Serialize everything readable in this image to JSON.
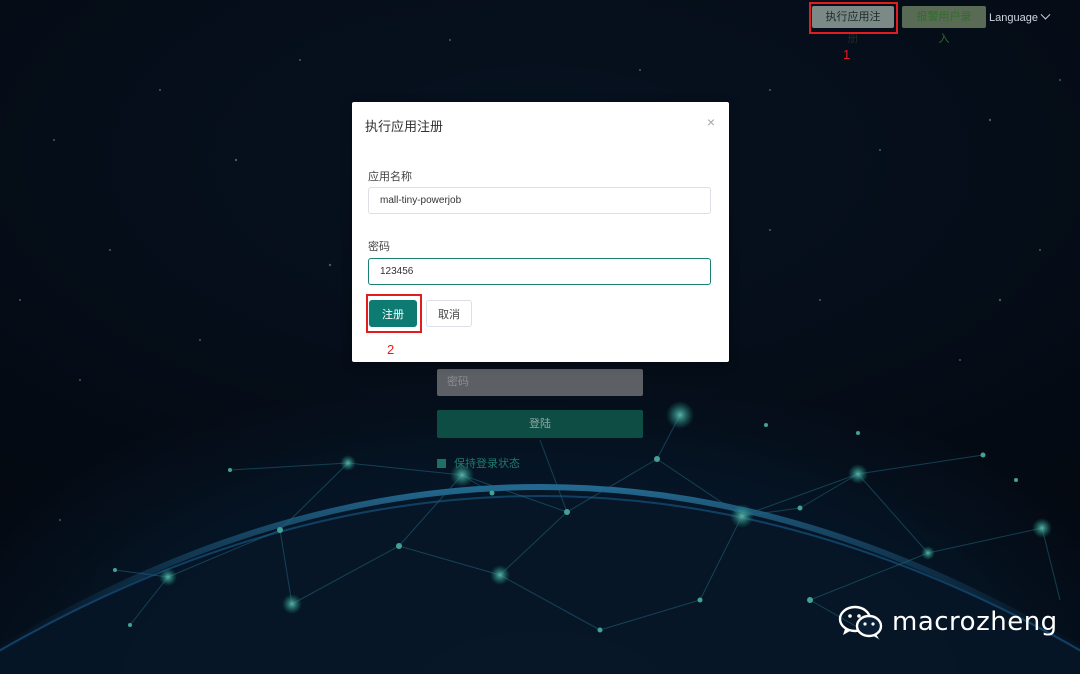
{
  "topbar": {
    "exec_register_label": "执行应用注册",
    "user_entry_label": "报警用户录入",
    "language_label": "Language"
  },
  "markers": {
    "first": "1",
    "second": "2"
  },
  "background_form": {
    "password_placeholder": "密码",
    "login_label": "登陆",
    "remember_label": "保持登录状态"
  },
  "dialog": {
    "title": "执行应用注册",
    "close_glyph": "×",
    "app_name_label": "应用名称",
    "app_name_value": "mall-tiny-powerjob",
    "password_label": "密码",
    "password_value": "123456",
    "register_label": "注册",
    "cancel_label": "取消"
  },
  "watermark": {
    "text": "macrozheng",
    "icon": "wechat-icon"
  },
  "colors": {
    "primary": "#0d7b72",
    "annotation_red": "#e21d1d",
    "background": "#050b16"
  }
}
